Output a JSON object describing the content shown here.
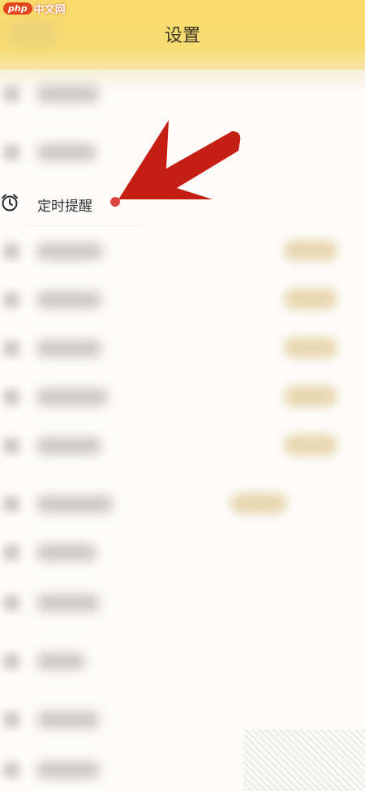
{
  "watermark": {
    "php": "php",
    "cn": "中文网"
  },
  "header": {
    "title": "设置"
  },
  "reminder": {
    "label": "定时提醒"
  },
  "icons": {
    "reminder_icon": "alarm-clock-icon"
  },
  "colors": {
    "header": "#f9da6a",
    "dot": "#d9463f",
    "arrow": "#c51f14"
  }
}
